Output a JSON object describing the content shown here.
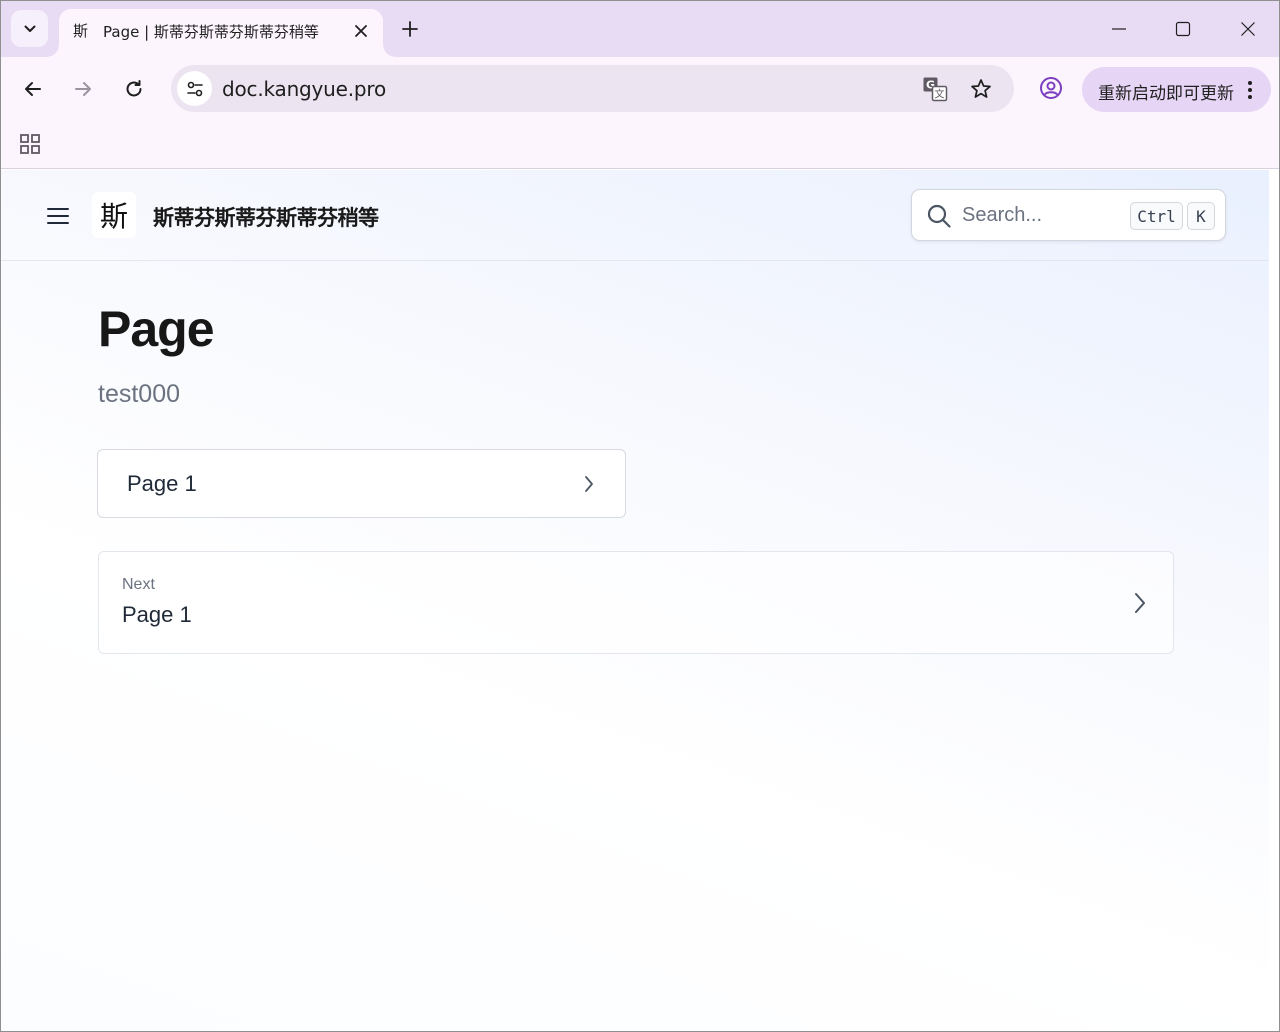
{
  "browser": {
    "tab": {
      "favicon_text": "斯",
      "title": "Page | 斯蒂芬斯蒂芬斯蒂芬稍等"
    },
    "address_bar": {
      "url": "doc.kangyue.pro"
    },
    "update_button": {
      "label": "重新启动即可更新"
    },
    "accent_color": "#7b3fbf"
  },
  "site": {
    "logo_text": "斯",
    "name": "斯蒂芬斯蒂芬斯蒂芬稍等",
    "search": {
      "placeholder": "Search...",
      "shortcut_keys": [
        "Ctrl",
        "K"
      ]
    }
  },
  "page": {
    "title": "Page",
    "subtitle": "test000",
    "cards": [
      {
        "label": "Page 1"
      }
    ],
    "pagination": {
      "hint": "Next",
      "title": "Page 1"
    }
  }
}
